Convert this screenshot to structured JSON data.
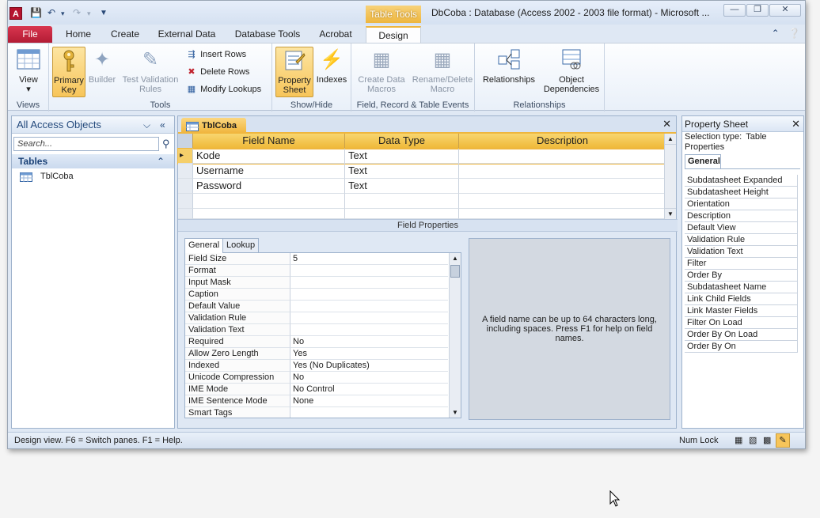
{
  "app": {
    "title": "DbCoba : Database (Access 2002 - 2003 file format)  -  Microsoft ...",
    "icon_letter": "A",
    "context_tab_header": "Table Tools"
  },
  "tabs": [
    "File",
    "Home",
    "Create",
    "External Data",
    "Database Tools",
    "Acrobat",
    "Design"
  ],
  "ribbon": {
    "views": {
      "view_label": "View",
      "group": "Views"
    },
    "tools": {
      "primary_key": "Primary Key",
      "builder": "Builder",
      "test_validation": "Test Validation Rules",
      "insert_rows": "Insert Rows",
      "delete_rows": "Delete Rows",
      "modify_lookups": "Modify Lookups",
      "group": "Tools"
    },
    "showhide": {
      "property_sheet": "Property Sheet",
      "indexes": "Indexes",
      "group": "Show/Hide"
    },
    "events": {
      "create_data_macros": "Create Data Macros",
      "rename_delete_macro": "Rename/Delete Macro",
      "group": "Field, Record & Table Events"
    },
    "relationships": {
      "relationships": "Relationships",
      "object_dependencies": "Object Dependencies",
      "group": "Relationships"
    }
  },
  "nav": {
    "header": "All Access Objects",
    "search_placeholder": "Search...",
    "section": "Tables",
    "items": [
      "TblCoba"
    ]
  },
  "document": {
    "tab": "TblCoba",
    "columns": [
      "Field Name",
      "Data Type",
      "Description"
    ],
    "rows": [
      {
        "field": "Kode",
        "type": "Text",
        "description": ""
      },
      {
        "field": "Username",
        "type": "Text",
        "description": ""
      },
      {
        "field": "Password",
        "type": "Text",
        "description": ""
      }
    ],
    "field_properties_label": "Field Properties",
    "fp_tabs": [
      "General",
      "Lookup"
    ],
    "properties": [
      {
        "name": "Field Size",
        "value": "5"
      },
      {
        "name": "Format",
        "value": ""
      },
      {
        "name": "Input Mask",
        "value": ""
      },
      {
        "name": "Caption",
        "value": ""
      },
      {
        "name": "Default Value",
        "value": ""
      },
      {
        "name": "Validation Rule",
        "value": ""
      },
      {
        "name": "Validation Text",
        "value": ""
      },
      {
        "name": "Required",
        "value": "No"
      },
      {
        "name": "Allow Zero Length",
        "value": "Yes"
      },
      {
        "name": "Indexed",
        "value": "Yes (No Duplicates)"
      },
      {
        "name": "Unicode Compression",
        "value": "No"
      },
      {
        "name": "IME Mode",
        "value": "No Control"
      },
      {
        "name": "IME Sentence Mode",
        "value": "None"
      },
      {
        "name": "Smart Tags",
        "value": ""
      }
    ],
    "help_text": "A field name can be up to 64 characters long, including spaces. Press F1 for help on field names."
  },
  "property_sheet": {
    "title": "Property Sheet",
    "selection_label": "Selection type:",
    "selection_value": "Table Properties",
    "tab": "General",
    "items": [
      "Subdatasheet Expanded",
      "Subdatasheet Height",
      "Orientation",
      "Description",
      "Default View",
      "Validation Rule",
      "Validation Text",
      "Filter",
      "Order By",
      "Subdatasheet Name",
      "Link Child Fields",
      "Link Master Fields",
      "Filter On Load",
      "Order By On Load",
      "Order By On"
    ]
  },
  "status": {
    "left": "Design view.  F6 = Switch panes.  F1 = Help.",
    "num_lock": "Num Lock"
  },
  "colors": {
    "accent_gold": "#eeb63e",
    "file_tab": "#b11a33",
    "frame_blue": "#dfe8f4"
  }
}
